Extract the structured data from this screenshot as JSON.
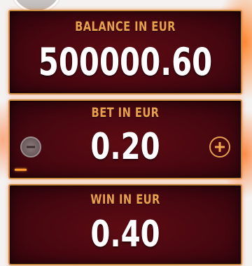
{
  "balance": {
    "label": "BALANCE IN EUR",
    "value": "500000.60"
  },
  "bet": {
    "label": "BET IN EUR",
    "value": "0.20",
    "decrease_icon": "minus-circle-icon",
    "increase_icon": "plus-circle-icon"
  },
  "win": {
    "label": "WIN IN EUR",
    "value": "0.40"
  },
  "colors": {
    "label": "#e8a04d",
    "value": "#ffffff",
    "panel_bg": "#460710",
    "panel_border": "#c9893f",
    "bet_indicator": "#ff9a2e"
  }
}
